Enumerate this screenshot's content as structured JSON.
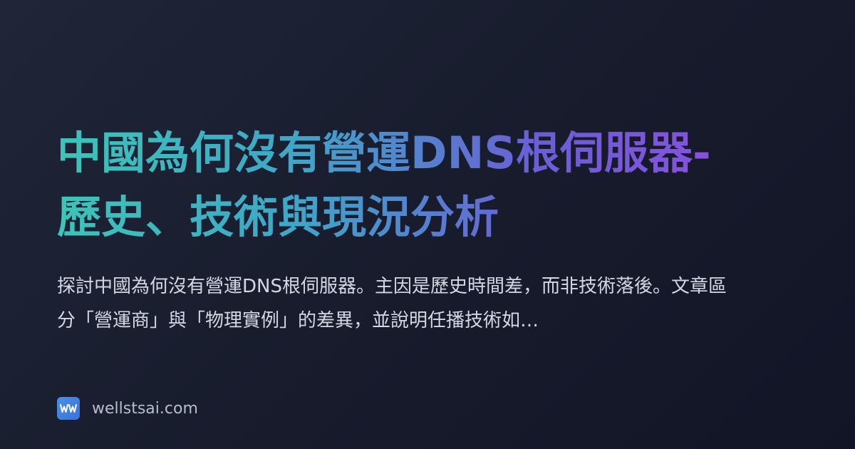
{
  "card": {
    "title": "中國為何沒有營運DNS根伺服器-歷史、技術與現況分析",
    "description": "探討中國為何沒有營運DNS根伺服器。主因是歷史時間差，而非技術落後。文章區分「營運商」與「物理實例」的差異，並說明任播技術如…",
    "site": {
      "logo_icon": "ww-logo-icon",
      "domain": "wellstsai.com"
    }
  },
  "colors": {
    "background_start": "#1f2638",
    "background_end": "#121526",
    "title_gradient_start": "#3cc5b8",
    "title_gradient_end": "#8a4fe0",
    "description_text": "#d4d8e2",
    "logo_blue": "#4a90e8"
  }
}
